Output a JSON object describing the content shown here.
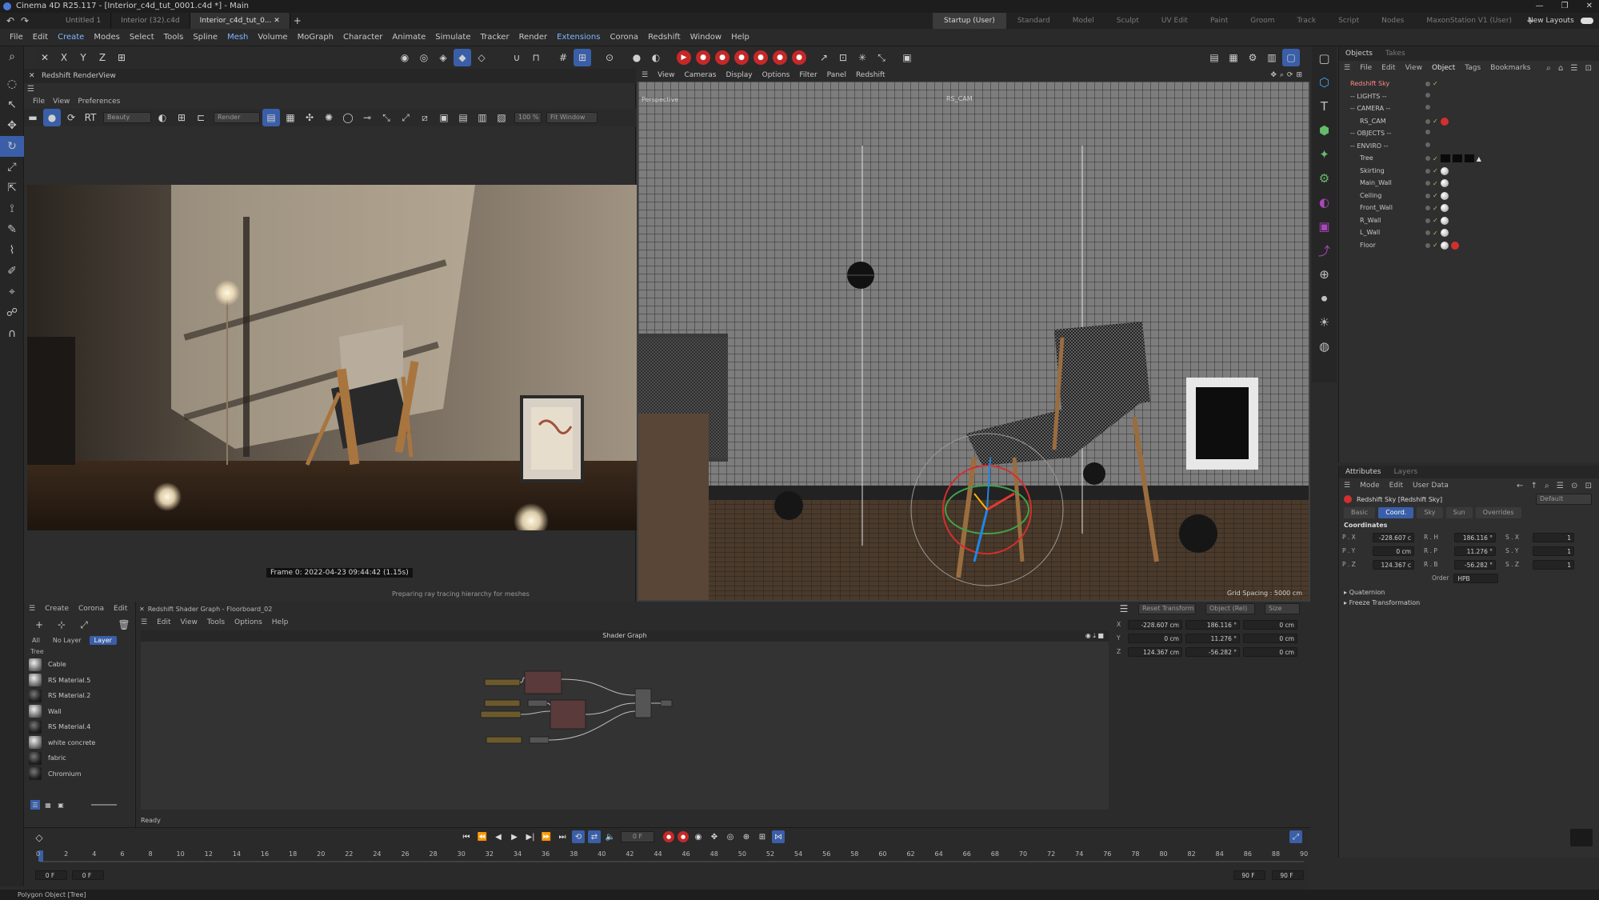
{
  "window": {
    "title": "Cinema 4D R25.117 - [Interior_c4d_tut_0001.c4d *] - Main",
    "controls": [
      "—",
      "❐",
      "✕"
    ]
  },
  "doc_tabs": [
    "Untitled 1",
    "Interior (32).c4d",
    "Interior_c4d_tut_0..."
  ],
  "layout_tabs": [
    "Startup (User)",
    "Standard",
    "Model",
    "Sculpt",
    "UV Edit",
    "Paint",
    "Groom",
    "Track",
    "Script",
    "Nodes",
    "MaxonStation V1 (User)"
  ],
  "new_layouts": "New Layouts",
  "menu": [
    "File",
    "Edit",
    "Create",
    "Modes",
    "Select",
    "Tools",
    "Spline",
    "Mesh",
    "Volume",
    "MoGraph",
    "Character",
    "Animate",
    "Simulate",
    "Tracker",
    "Render",
    "Extensions",
    "Corona",
    "Redshift",
    "Window",
    "Help"
  ],
  "renderview": {
    "title": "Redshift RenderView",
    "menu": [
      "File",
      "View",
      "Preferences"
    ],
    "aov": "Beauty",
    "render_mode": "Render",
    "zoom": "100 %",
    "fit": "Fit Window",
    "frame_info": "Frame  0:  2022-04-23  09:44:42  (1.15s)",
    "status": "Preparing ray tracing hierarchy for meshes"
  },
  "viewport": {
    "menu": [
      "View",
      "Cameras",
      "Display",
      "Options",
      "Filter",
      "Panel",
      "Redshift"
    ],
    "label": "Perspective",
    "camera": "RS_CAM",
    "grid_spacing": "Grid Spacing : 5000 cm"
  },
  "objects": {
    "tabs": [
      "Objects",
      "Takes"
    ],
    "menu": [
      "File",
      "Edit",
      "View",
      "Object",
      "Tags",
      "Bookmarks"
    ],
    "rows": [
      {
        "name": "Redshift Sky",
        "indent": 0
      },
      {
        "name": "-- LIGHTS --",
        "indent": 0
      },
      {
        "name": "-- CAMERA --",
        "indent": 0
      },
      {
        "name": "RS_CAM",
        "indent": 1
      },
      {
        "name": "-- OBJECTS --",
        "indent": 0
      },
      {
        "name": "-- ENVIRO --",
        "indent": 0
      },
      {
        "name": "Tree",
        "indent": 1
      },
      {
        "name": "Skirting",
        "indent": 1
      },
      {
        "name": "Main_Wall",
        "indent": 1
      },
      {
        "name": "Ceiling",
        "indent": 1
      },
      {
        "name": "Front_Wall",
        "indent": 1
      },
      {
        "name": "R_Wall",
        "indent": 1
      },
      {
        "name": "L_Wall",
        "indent": 1
      },
      {
        "name": "Floor",
        "indent": 1
      }
    ]
  },
  "attributes": {
    "tabs": [
      "Attributes",
      "Layers"
    ],
    "menu": [
      "Mode",
      "Edit",
      "User Data"
    ],
    "object": "Redshift Sky [Redshift Sky]",
    "preset": "Default",
    "subtabs": [
      "Basic",
      "Coord.",
      "Sky",
      "Sun",
      "Overrides"
    ],
    "section": "Coordinates",
    "rows": [
      {
        "a": "P . X",
        "av": "-228.607 c",
        "b": "R . H",
        "bv": "186.116 °",
        "c": "S . X",
        "cv": "1"
      },
      {
        "a": "P . Y",
        "av": "0 cm",
        "b": "R . P",
        "bv": "11.276 °",
        "c": "S . Y",
        "cv": "1"
      },
      {
        "a": "P . Z",
        "av": "124.367 c",
        "b": "R . B",
        "bv": "-56.282 °",
        "c": "S . Z",
        "cv": "1"
      }
    ],
    "order_label": "Order",
    "order_value": "HPB",
    "groups": [
      "Quaternion",
      "Freeze Transformation"
    ]
  },
  "materials": {
    "menu": [
      "Create",
      "Corona",
      "Edit"
    ],
    "filters": [
      "All",
      "No Layer",
      "Layer"
    ],
    "header": "Tree",
    "items": [
      {
        "name": "Cable",
        "dark": false
      },
      {
        "name": "RS Material.5",
        "dark": false
      },
      {
        "name": "RS Material.2",
        "dark": true
      },
      {
        "name": "Wall",
        "dark": false
      },
      {
        "name": "RS Material.4",
        "dark": true
      },
      {
        "name": "white concrete",
        "dark": false
      },
      {
        "name": "fabric",
        "dark": true
      },
      {
        "name": "Chromium",
        "dark": true
      }
    ]
  },
  "shader_graph": {
    "title": "Redshift Shader Graph - Floorboard_02",
    "menu": [
      "Edit",
      "View",
      "Tools",
      "Options",
      "Help"
    ],
    "header": "Shader Graph",
    "status": "Ready"
  },
  "coord_panel": {
    "reset": "Reset Transform",
    "mode": "Object (Rel)",
    "size": "Size",
    "rows": [
      {
        "axis": "X",
        "p": "-228.607 cm",
        "r": "186.116 °",
        "s": "0 cm"
      },
      {
        "axis": "Y",
        "p": "0 cm",
        "r": "11.276 °",
        "s": "0 cm"
      },
      {
        "axis": "Z",
        "p": "124.367 cm",
        "r": "-56.282 °",
        "s": "0 cm"
      }
    ]
  },
  "timeline": {
    "current": "0 F",
    "start": "0 F",
    "start2": "0 F",
    "end": "90 F",
    "end2": "90 F",
    "ticks": [
      "0",
      "2",
      "4",
      "6",
      "8",
      "10",
      "12",
      "14",
      "16",
      "18",
      "20",
      "22",
      "24",
      "26",
      "28",
      "30",
      "32",
      "34",
      "36",
      "38",
      "40",
      "42",
      "44",
      "46",
      "48",
      "50",
      "52",
      "54",
      "56",
      "58",
      "60",
      "62",
      "64",
      "66",
      "68",
      "70",
      "72",
      "74",
      "76",
      "78",
      "80",
      "82",
      "84",
      "86",
      "88",
      "90"
    ]
  },
  "statusbar": "Polygon Object [Tree]"
}
